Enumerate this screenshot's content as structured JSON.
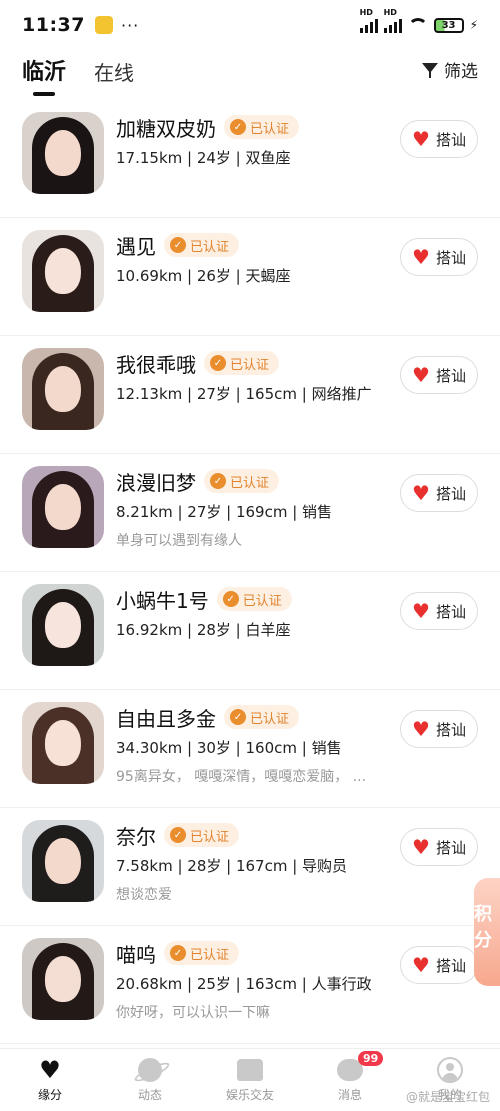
{
  "status_bar": {
    "time": "11:37",
    "dots": "···",
    "battery": "33",
    "signal_label": "HD"
  },
  "tabs": [
    {
      "label": "临沂"
    },
    {
      "label": "在线"
    }
  ],
  "filter_label": "筛选",
  "greet_label": "搭讪",
  "verified_label": "已认证",
  "users": [
    {
      "name": "加糖双皮奶",
      "meta": "17.15km | 24岁 | 双鱼座",
      "bio": ""
    },
    {
      "name": "遇见",
      "meta": "10.69km | 26岁 | 天蝎座",
      "bio": ""
    },
    {
      "name": "我很乖哦",
      "meta": "12.13km | 27岁 | 165cm | 网络推广",
      "bio": ""
    },
    {
      "name": "浪漫旧梦",
      "meta": "8.21km | 27岁 | 169cm | 销售",
      "bio": "单身可以遇到有缘人"
    },
    {
      "name": "小蜗牛1号",
      "meta": "16.92km | 28岁 | 白羊座",
      "bio": ""
    },
    {
      "name": "自由且多金",
      "meta": "34.30km | 30岁 | 160cm | 销售",
      "bio": "95离异女， 嘎嘎深情，嘎嘎恋爱脑，  ..."
    },
    {
      "name": "奈尔",
      "meta": "7.58km | 28岁 | 167cm | 导购员",
      "bio": "想谈恋爱"
    },
    {
      "name": "喵呜",
      "meta": "20.68km | 25岁 | 163cm | 人事行政",
      "bio": "你好呀，可以认识一下嘛"
    }
  ],
  "side_float_text": "积分",
  "bottom_nav": [
    {
      "label": "缘分"
    },
    {
      "label": "动态"
    },
    {
      "label": "娱乐交友"
    },
    {
      "label": "消息",
      "badge": "99"
    },
    {
      "label": "我的"
    }
  ],
  "watermark": "@就是宝宝红包"
}
